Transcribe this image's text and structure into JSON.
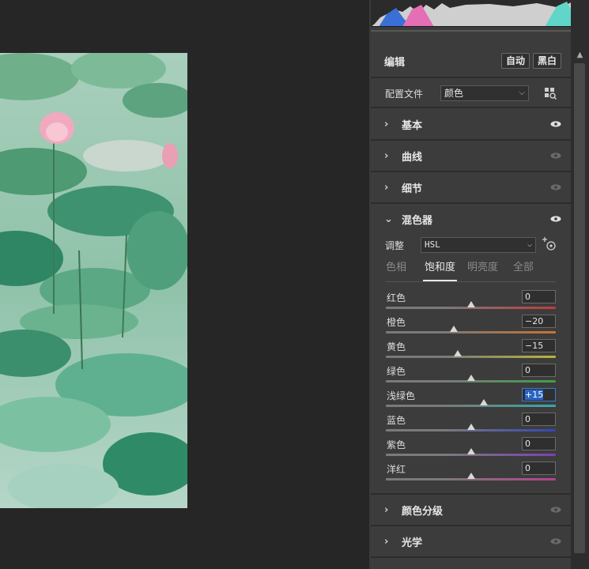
{
  "panel": {
    "edit_title": "编辑",
    "auto_label": "自动",
    "bw_label": "黑白",
    "profile_label": "配置文件",
    "profile_value": "颜色"
  },
  "sections": {
    "basic": "基本",
    "curve": "曲线",
    "detail": "细节",
    "mixer": "混色器",
    "color_grading": "颜色分级",
    "optics": "光学"
  },
  "mixer": {
    "adjust_label": "调整",
    "adjust_value": "HSL",
    "tabs": [
      "色相",
      "饱和度",
      "明亮度",
      "全部"
    ],
    "active_tab": "饱和度",
    "sliders": [
      {
        "label": "红色",
        "value": "0",
        "fraction": 0.5,
        "color": "#c23c3c"
      },
      {
        "label": "橙色",
        "value": "−20",
        "fraction": 0.4,
        "color": "#c9722e"
      },
      {
        "label": "黄色",
        "value": "−15",
        "fraction": 0.425,
        "color": "#b9b537"
      },
      {
        "label": "绿色",
        "value": "0",
        "fraction": 0.5,
        "color": "#3ca046"
      },
      {
        "label": "浅绿色",
        "value": "+15",
        "fraction": 0.575,
        "color": "#36a7a4"
      },
      {
        "label": "蓝色",
        "value": "0",
        "fraction": 0.5,
        "color": "#3346b8"
      },
      {
        "label": "紫色",
        "value": "0",
        "fraction": 0.5,
        "color": "#7e3fb5"
      },
      {
        "label": "洋红",
        "value": "0",
        "fraction": 0.5,
        "color": "#b8408f"
      }
    ]
  },
  "colors": {
    "panel_bg": "#3c3c3c",
    "canvas_bg": "#262626",
    "focus_blue": "#2a64c5"
  },
  "icons": {
    "expand": "chevron-right-icon",
    "collapse": "chevron-down-icon",
    "visibility": "eye-icon",
    "profile_browser": "grid-search-icon",
    "target_adjust": "target-adjust-icon"
  }
}
